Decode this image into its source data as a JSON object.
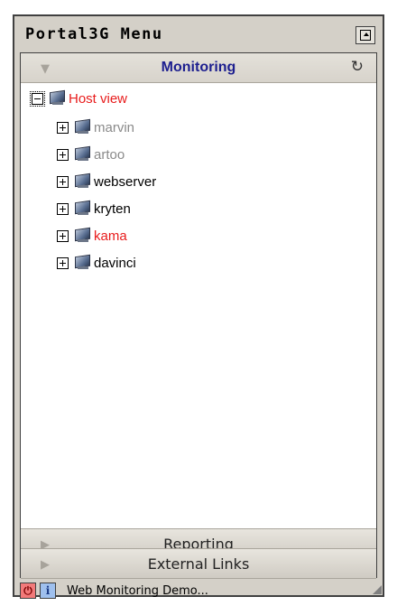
{
  "window": {
    "title": "Portal3G Menu"
  },
  "monitoring": {
    "title": "Monitoring",
    "arrow": "▼",
    "refresh": "↻"
  },
  "tree": {
    "root": {
      "label": "Host view",
      "color": "#e81c1c"
    },
    "hosts": [
      {
        "label": "marvin",
        "color": "#8a8a8a"
      },
      {
        "label": "artoo",
        "color": "#8a8a8a"
      },
      {
        "label": "webserver",
        "color": "#000000"
      },
      {
        "label": "kryten",
        "color": "#000000"
      },
      {
        "label": "kama",
        "color": "#e81c1c"
      },
      {
        "label": "davinci",
        "color": "#000000"
      }
    ]
  },
  "sections": {
    "reporting": {
      "title": "Reporting",
      "arrow": "▶"
    },
    "external": {
      "title": "External Links",
      "arrow": "▶"
    }
  },
  "statusbar": {
    "power_icon": "power-icon",
    "info_icon": "info-icon",
    "power_glyph": "⏻",
    "info_glyph": "i",
    "text": "Web Monitoring Demo..."
  }
}
